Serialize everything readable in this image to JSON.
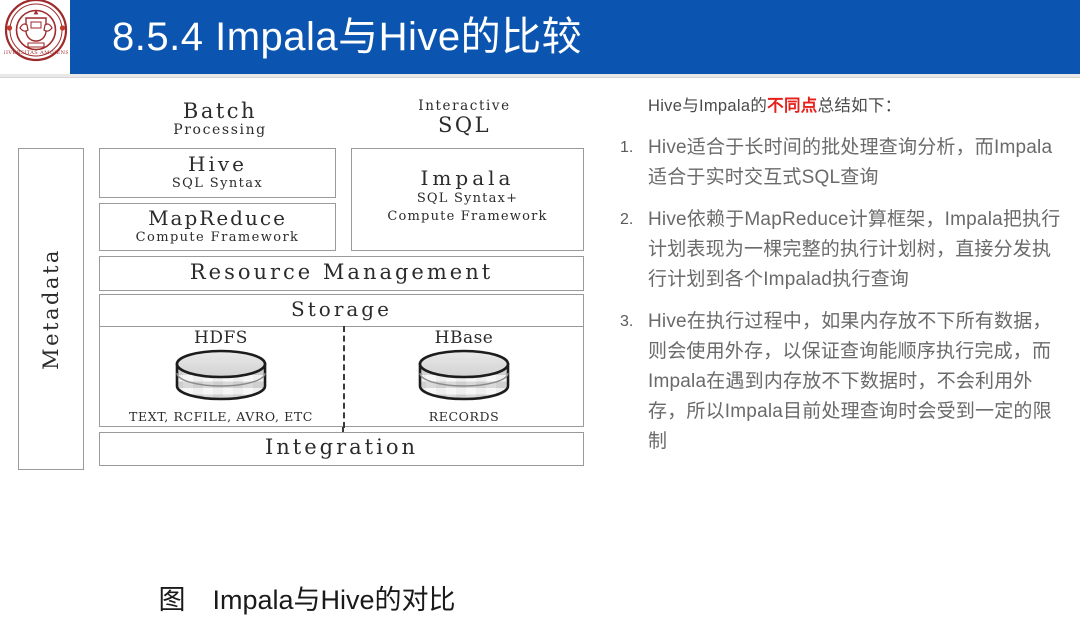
{
  "header": {
    "title": "8.5.4 Impala与Hive的比较",
    "banner_color": "#0B55B0",
    "logo_icon": "university-seal-icon"
  },
  "diagram": {
    "column_headings": [
      {
        "big": "Batch",
        "small": "Processing"
      },
      {
        "big": "SQL",
        "small": "Interactive"
      }
    ],
    "metadata_box": "Metadata",
    "hive_box": {
      "title": "Hive",
      "subtitle": "SQL Syntax"
    },
    "mapreduce_box": {
      "title": "MapReduce",
      "subtitle": "Compute Framework"
    },
    "impala_box": {
      "title": "Impala",
      "subtitle_line1": "SQL Syntax+",
      "subtitle_line2": "Compute Framework"
    },
    "resource_box": "Resource Management",
    "storage_box": {
      "title": "Storage",
      "cells": [
        {
          "name": "HDFS",
          "sub": "TEXT, RCFILE, AVRO, ETC",
          "icon": "database-cylinder-icon"
        },
        {
          "name": "HBase",
          "sub": "RECORDS",
          "icon": "database-cylinder-icon"
        }
      ]
    },
    "integration_box": "Integration",
    "caption": "图　Impala与Hive的对比"
  },
  "panel": {
    "intro_before": "Hive与Impala的",
    "intro_highlight": "不同点",
    "intro_after": "总结如下：",
    "highlight_color": "#E8201C",
    "bullets": [
      {
        "num": "1.",
        "text": "Hive适合于长时间的批处理查询分析，而Impala适合于实时交互式SQL查询"
      },
      {
        "num": "2.",
        "text": "Hive依赖于MapReduce计算框架，Impala把执行计划表现为一棵完整的执行计划树，直接分发执行计划到各个Impalad执行查询"
      },
      {
        "num": "3.",
        "text": "Hive在执行过程中，如果内存放不下所有数据，则会使用外存，以保证查询能顺序执行完成，而Impala在遇到内存放不下数据时，不会利用外存，所以Impala目前处理查询时会受到一定的限制"
      }
    ]
  }
}
